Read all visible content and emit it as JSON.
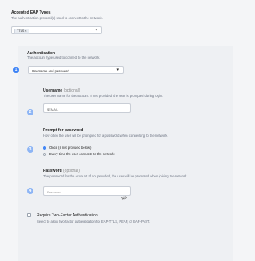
{
  "eap": {
    "title": "Accepted EAP Types",
    "subtitle": "The authentication protocol(s) used to connect to the network.",
    "selected_tag": "TTLS",
    "tag_remove": "×"
  },
  "authentication": {
    "title": "Authentication",
    "subtitle": "The account type used to connect to the network.",
    "selected": "Username and password"
  },
  "steps": [
    "1",
    "2",
    "3",
    "4"
  ],
  "username": {
    "title": "Username",
    "optional": "(optional)",
    "subtitle": "The user name for the account. If not provided, the user is prompted during login.",
    "value": "$EMAIL"
  },
  "prompt": {
    "title": "Prompt for password",
    "subtitle": "How often the user will be prompted for a password when connecting to the network.",
    "options": [
      {
        "label": "Once (if not provided below)",
        "selected": true
      },
      {
        "label": "Every time the user connects to the network",
        "selected": false
      }
    ]
  },
  "password": {
    "title": "Password",
    "optional": "(optional)",
    "subtitle": "The password for the account. If not provided, the user will be prompted when joining the network.",
    "placeholder": "Password"
  },
  "two_factor": {
    "title": "Require Two-Factor Authentication",
    "subtitle": "Select to allow two-factor authentication for EAP-TTLS, PEAP, or EAP-FAST.",
    "checked": false
  },
  "colors": {
    "accent": "#3b82f6",
    "step_light": "#8db5f5"
  },
  "icons": {
    "chevron": "chevron-down-icon",
    "eye": "eye-off-icon"
  }
}
